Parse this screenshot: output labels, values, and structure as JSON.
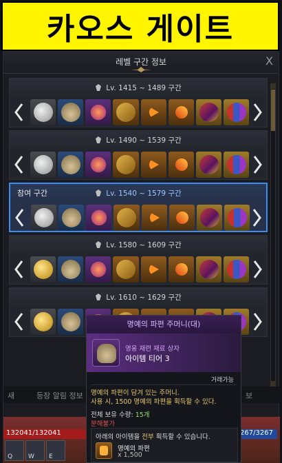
{
  "banner": {
    "title": "카오스 게이트"
  },
  "window": {
    "title": "레벨 구간 정보",
    "close_label": "X"
  },
  "tiers": [
    {
      "range": "Lv. 1415 ~ 1489 구간",
      "badge": ""
    },
    {
      "range": "Lv. 1490 ~ 1539 구간",
      "badge": ""
    },
    {
      "range": "Lv. 1540 ~ 1579 구간",
      "badge": "참여 구간"
    },
    {
      "range": "Lv. 1580 ~ 1609 구간",
      "badge": ""
    },
    {
      "range": "Lv. 1610 ~ 1629 구간",
      "badge": ""
    }
  ],
  "reward_icons": [
    "silver-coin-icon",
    "honor-shard-bag-icon",
    "fire-gem-icon",
    "book-icon",
    "arrow-piece-icon",
    "leapstone-icon",
    "scroll-icon",
    "card-pack-icon"
  ],
  "hud": {
    "tab_left": "새",
    "tab_text": "등장 알림 정보",
    "tab_right": "보",
    "hp": "132041/132041",
    "mp": "267/3267",
    "keys": [
      "Q",
      "W",
      "E"
    ]
  },
  "tooltip": {
    "title": "명예의 파편 주머니(대)",
    "item_type": "영웅 재련 재료 상자",
    "item_tier": "아이템 티어 3",
    "tradable": "거래가능",
    "description_1": "명예의 파편이 담겨 있는 주머니.",
    "description_2": "사용 시, 1500 명예의 파편을 획득할 수 있다.",
    "hold_label": "전체 보유 수량:",
    "hold_value": "15개",
    "no_disassemble": "분해불가",
    "box_head_pre": "아래의 아이템을",
    "box_head_emph": "전부",
    "box_head_post": "획득할 수 있습니다.",
    "reward_name": "명예의 파편",
    "reward_qty": "x 1,500"
  },
  "colors": {
    "banner": "#fff500",
    "active_border": "#3e8df0",
    "tooltip_title": "#d7b7ff"
  }
}
